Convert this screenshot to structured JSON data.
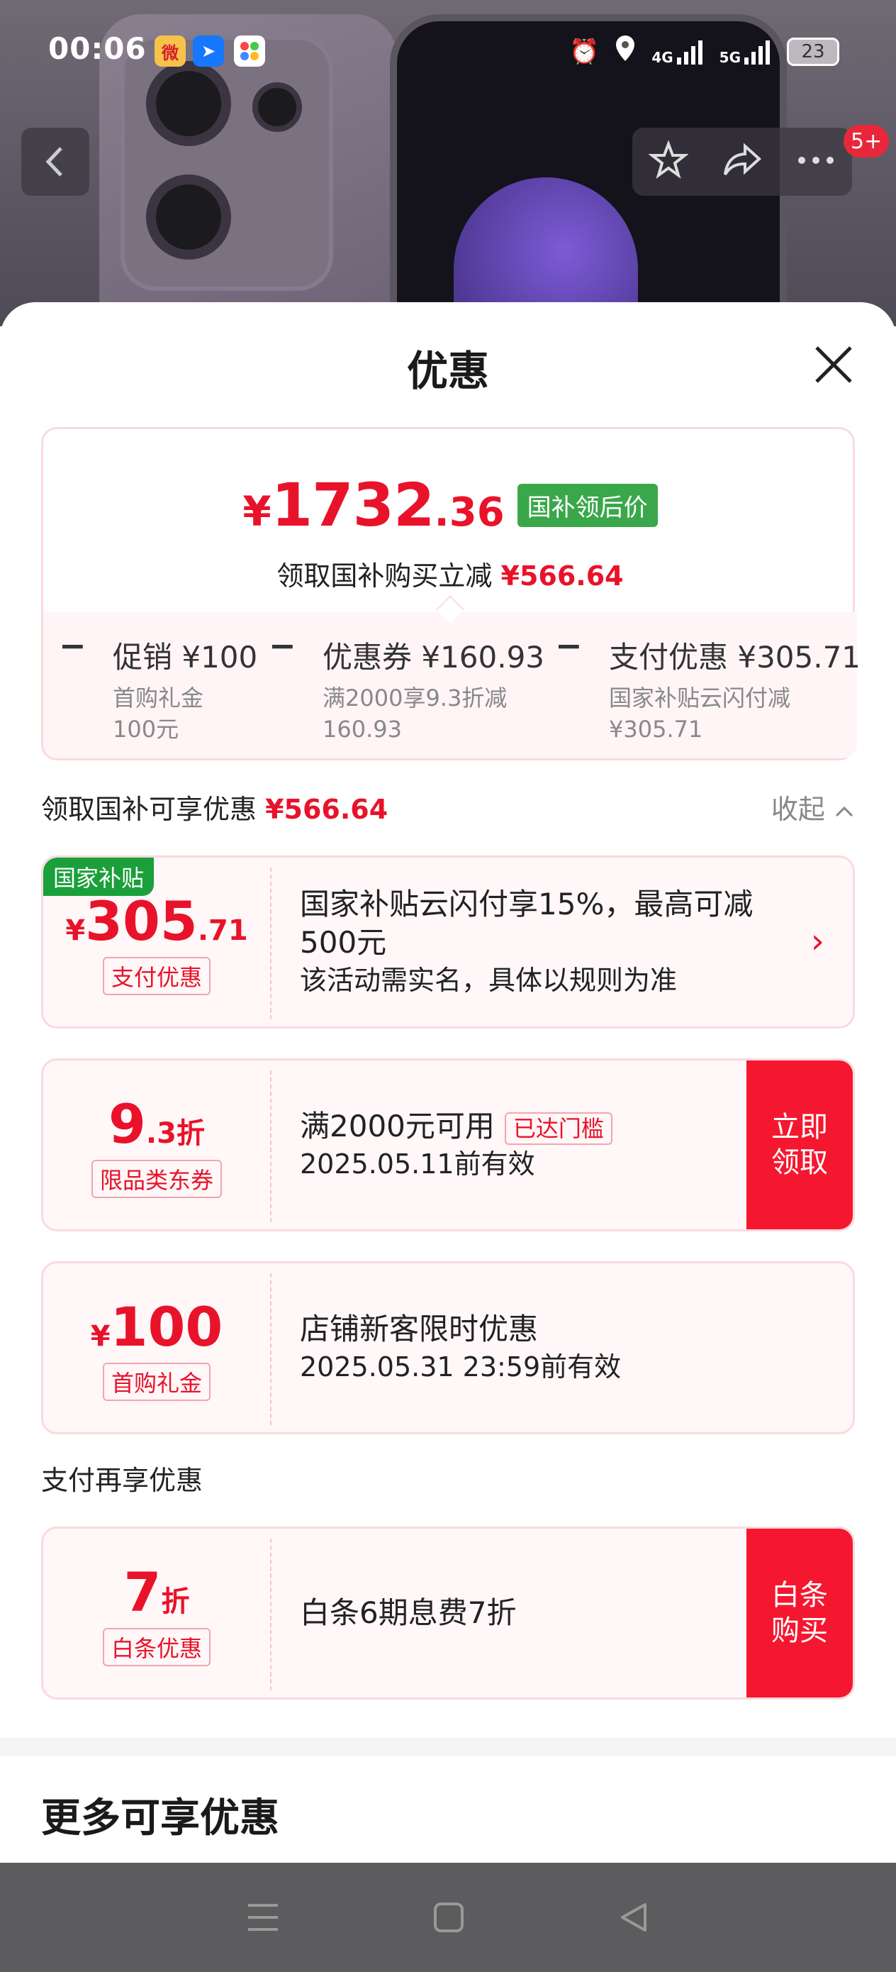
{
  "status_bar": {
    "time": "00:06",
    "network_4g": "4G",
    "network_5g": "5G",
    "battery": "23"
  },
  "nav": {
    "badge": "5+"
  },
  "sheet": {
    "title": "优惠"
  },
  "summary": {
    "price_symbol": "¥",
    "price_integer": "1732",
    "price_decimal": ".36",
    "price_tag": "国补领后价",
    "subtitle_text": "领取国补购买立减",
    "subtitle_amount": "¥566.64",
    "breakdown": [
      {
        "minus": "−",
        "main": "促销 ¥100",
        "sub1": "首购礼金",
        "sub2": "100元"
      },
      {
        "minus": "−",
        "main": "优惠券 ¥160.93",
        "sub1": "满2000享9.3折减",
        "sub2": "160.93"
      },
      {
        "minus": "−",
        "main": "支付优惠 ¥305.71",
        "sub1": "国家补贴云闪付减",
        "sub2": "¥305.71"
      }
    ]
  },
  "section_subsidy": {
    "title": "领取国补可享优惠",
    "amount": "¥566.64",
    "collapse_label": "收起"
  },
  "cards": [
    {
      "corner_tag": "国家补贴",
      "symbol": "¥",
      "big": "305",
      "decimal": ".71",
      "tag": "支付优惠",
      "line1": "国家补贴云闪付享15%，最高可减500元",
      "line2": "该活动需实名，具体以规则为准"
    },
    {
      "symbol": "",
      "big": "9",
      "decimal": ".3折",
      "tag": "限品类东券",
      "line1": "满2000元可用",
      "reached": "已达门槛",
      "line2": "2025.05.11前有效",
      "action": [
        "立即",
        "领取"
      ]
    },
    {
      "symbol": "¥",
      "big": "100",
      "decimal": "",
      "tag": "首购礼金",
      "line1": "店铺新客限时优惠",
      "line2": "2025.05.31 23:59前有效"
    }
  ],
  "pay_section": {
    "title": "支付再享优惠",
    "card": {
      "big": "7",
      "decimal": "折",
      "tag": "白条优惠",
      "line1": "白条6期息费7折",
      "action": [
        "白条",
        "购买"
      ]
    }
  },
  "more": {
    "title": "更多可享优惠"
  },
  "colors": {
    "accent_red": "#e8132a",
    "action_red": "#f5172f",
    "subsidy_green": "#1aa03a",
    "price_tag_green": "#3aa84a"
  },
  "icons": [
    "weibo-icon",
    "alipay-icon",
    "app-icon",
    "alarm-icon",
    "location-icon",
    "signal-icon",
    "back-arrow-icon",
    "star-icon",
    "share-icon",
    "more-icon",
    "close-icon",
    "chevron-up-icon",
    "chevron-right-icon",
    "menu-icon",
    "home-icon",
    "back-triangle-icon"
  ]
}
